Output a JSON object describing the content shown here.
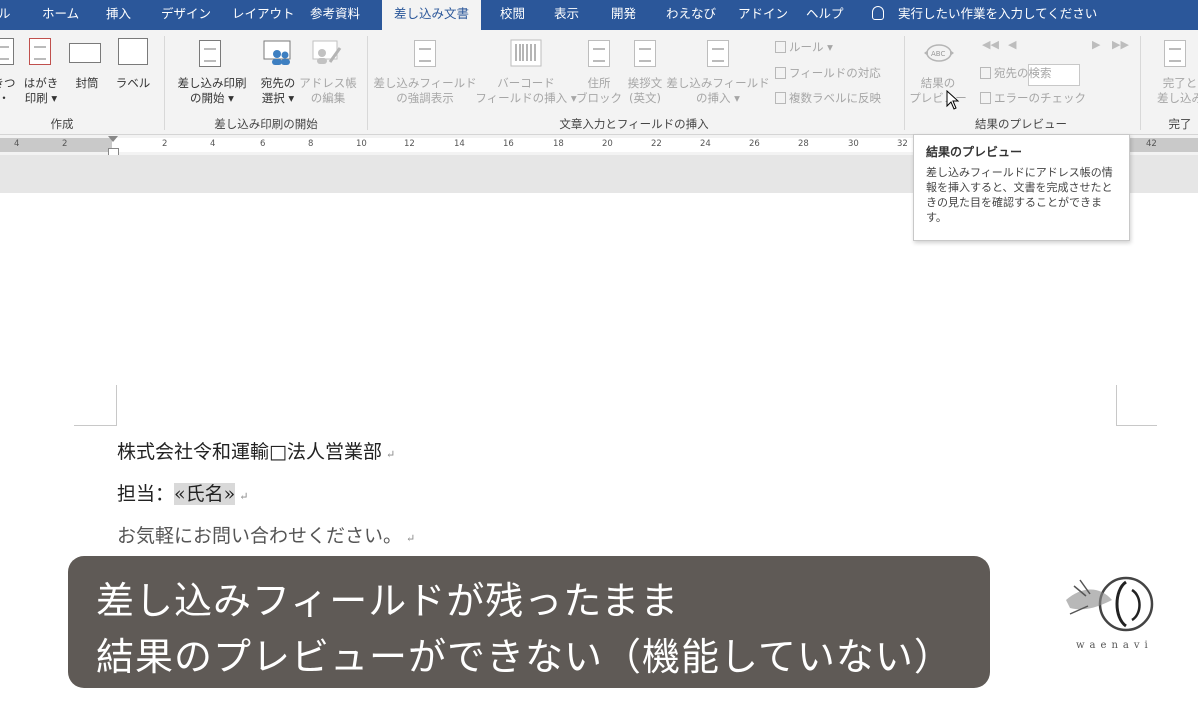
{
  "tabs": [
    "ル",
    "ホーム",
    "挿入",
    "デザイン",
    "レイアウト",
    "参考資料",
    "差し込み文書",
    "校閲",
    "表示",
    "開発",
    "わえなび",
    "アドイン",
    "ヘルプ"
  ],
  "tell_me": "実行したい作業を入力してください",
  "groups": {
    "create": "作成",
    "start": "差し込み印刷の開始",
    "fields": "文章入力とフィールドの挿入",
    "preview": "結果のプレビュー",
    "finish": "完了"
  },
  "buttons": {
    "envelopes_partial": "きつ\n・",
    "postcard": "はがき\n印刷 ▾",
    "envelope": "封筒",
    "label": "ラベル",
    "start_merge": "差し込み印刷\nの開始 ▾",
    "select_recipients": "宛先の\n選択 ▾",
    "edit_list": "アドレス帳\nの編集",
    "highlight_fields": "差し込みフィールド\nの強調表示",
    "barcode": "バーコード\nフィールドの挿入 ▾",
    "address_block": "住所\nブロック",
    "greeting": "挨拶文\n(英文)",
    "insert_field": "差し込みフィールド\nの挿入 ▾",
    "rules": "ルール ▾",
    "match_fields": "フィールドの対応",
    "update_labels": "複数ラベルに反映",
    "preview_results": "結果の\nプレビュー",
    "find_recipient": "宛先の検索",
    "check_errors": "エラーのチェック",
    "finish_merge": "完了と\n差し込み"
  },
  "ruler": [
    "4",
    "2",
    "2",
    "4",
    "6",
    "8",
    "10",
    "12",
    "14",
    "16",
    "18",
    "20",
    "22",
    "24",
    "26",
    "28",
    "30",
    "32",
    "42"
  ],
  "tooltip": {
    "title": "結果のプレビュー",
    "body": "差し込みフィールドにアドレス帳の情報を挿入すると、文書を完成させたときの見た目を確認することができます。"
  },
  "document": {
    "line1": "株式会社令和運輸□法人営業部",
    "line2_prefix": "担当：",
    "line2_field": "«氏名»",
    "line3": "お気軽にお問い合わせください。"
  },
  "caption": {
    "line1": "差し込みフィールドが残ったまま",
    "line2": "結果のプレビューができない（機能していない）"
  },
  "logo_text": "waenavi",
  "colors": {
    "ribbon_tab": "#2b579a",
    "caption_bg": "#5f5a56"
  }
}
